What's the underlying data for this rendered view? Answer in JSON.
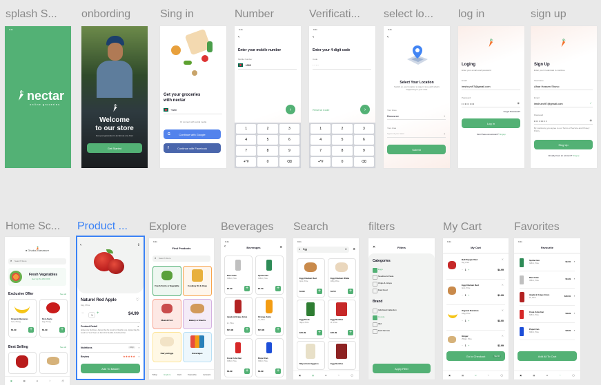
{
  "row1_titles": [
    "splash S...",
    "onbording",
    "Sing in",
    "Number",
    "Verificati...",
    "select lo...",
    "log in",
    "sign up"
  ],
  "row2_titles": [
    "Home Sc...",
    "Product ...",
    "Explore",
    "Beverages",
    "Search",
    "filters",
    "My Cart",
    "Favorites"
  ],
  "colors": {
    "brand_green": "#53b175",
    "selected_blue": "#3b82f6",
    "canvas": "#e9e9e9"
  },
  "splash": {
    "logo": "nectar",
    "tagline": "online groceries"
  },
  "onboarding": {
    "title_line1": "Welcome",
    "title_line2": "to our store",
    "subtitle": "Get your groceries in as fast as one hour",
    "button": "Get Started"
  },
  "signin": {
    "title_line1": "Get your groceries",
    "title_line2": "with nectar",
    "phone": "+880",
    "social_note": "Or connect with social media",
    "google_btn": "Continue with Google",
    "facebook_btn": "Continue with Facebook"
  },
  "number": {
    "title": "Enter your mobile number",
    "label": "Mobile Number",
    "value": "+880",
    "keys": [
      "1",
      "2",
      "3",
      "4",
      "5",
      "6",
      "7",
      "8",
      "9",
      "+*#",
      "0",
      "⌫"
    ]
  },
  "verification": {
    "title": "Enter your 4-digit code",
    "label": "Code",
    "resend": "Resend Code",
    "keys": [
      "1",
      "2",
      "3",
      "4",
      "5",
      "6",
      "7",
      "8",
      "9",
      "+*#",
      "0",
      "⌫"
    ]
  },
  "location": {
    "title": "Select Your Location",
    "subtitle": "Switch on your location to stay in tune with what's happening in your area",
    "zone_label": "Your Zone",
    "zone_value": "Banasree",
    "area_label": "Your Area",
    "area_placeholder": "Types of your area",
    "button": "Submit"
  },
  "login": {
    "title": "Loging",
    "subtitle": "Enter your emails and password",
    "email_label": "Email",
    "email_value": "imshuvo97@gmail.com",
    "password_label": "Password",
    "password_value": "••••••••",
    "forgot": "Forgot Password?",
    "button": "Log In",
    "signup_prompt": "Don't have an account?",
    "signup_link": "Singup"
  },
  "signup": {
    "title": "Sign Up",
    "subtitle": "Enter your credentials to continue",
    "username_label": "Username",
    "username_value": "Afsar Hossen Shuvo",
    "email_label": "Email",
    "email_value": "imshuvo97@gmail.com",
    "password_label": "Password",
    "password_value": "••••••••",
    "terms": "By continuing you agree to our Terms of Service and Privacy Policy.",
    "button": "Sing Up",
    "login_prompt": "Already have an account?",
    "login_link": "Singup"
  },
  "home": {
    "location": "Dhaka, Banassre",
    "search": "Search Store",
    "banner_title": "Fresh Vegetables",
    "banner_sub": "Get Up To 40% OFF",
    "section1": "Exclusive Offer",
    "see_all": "See all",
    "products": [
      {
        "name": "Organic Bananas",
        "qty": "7pcs, Priceg",
        "price": "$4.99"
      },
      {
        "name": "Red Apple",
        "qty": "1kg, Priceg",
        "price": "$4.99"
      }
    ],
    "section2": "Best Selling"
  },
  "product": {
    "name": "Naturel Red Apple",
    "qty": "1kg, Price",
    "price": "$4.99",
    "count": "1",
    "detail_label": "Product Detail",
    "detail_text": "Apples Are Nutritious. Apples May Be Good For Weight Loss. Apples May Be Good For Your Heart. As Part Of A Healtful And Varied Diet.",
    "nutrition": "Nutritions",
    "nutrition_value": "100gr",
    "review": "Review",
    "stars": "★★★★★",
    "button": "Add To Basket"
  },
  "explore": {
    "title": "Find Products",
    "search": "Search Store",
    "categories": [
      {
        "label": "Frash Fruits & Vegetable",
        "bg": "#eef7f1",
        "border": "#53b175"
      },
      {
        "label": "Cooking Oil & Ghee",
        "bg": "#fef6ed",
        "border": "#f8a44c"
      },
      {
        "label": "Meat & Fish",
        "bg": "#fde8e4",
        "border": "#f7a593"
      },
      {
        "label": "Bakery & Snacks",
        "bg": "#f4ebf7",
        "border": "#d3b0e0"
      },
      {
        "label": "Dairy & Eggs",
        "bg": "#fff8e5",
        "border": "#fde598"
      },
      {
        "label": "Beverages",
        "bg": "#edf7fc",
        "border": "#b7dff5"
      }
    ],
    "tabs": [
      "Shop",
      "Explore",
      "Cart",
      "Favourite",
      "Account"
    ]
  },
  "beverages": {
    "title": "Beverages",
    "items": [
      {
        "name": "Diet Coke",
        "qty": "355ml, Price",
        "price": "$1.99"
      },
      {
        "name": "Sprite Can",
        "qty": "325ml, Price",
        "price": "$1.50"
      },
      {
        "name": "Apple & Grape Juice",
        "qty": "2L, Price",
        "price": "$15.99"
      },
      {
        "name": "Orenge Juice",
        "qty": "2L, Price",
        "price": "$15.99"
      },
      {
        "name": "Coca Cola Can",
        "qty": "325ml, Price",
        "price": "$4.99"
      },
      {
        "name": "Pepsi Can",
        "qty": "330ml, Price",
        "price": "$4.99"
      }
    ]
  },
  "search": {
    "query": "Egg",
    "items": [
      {
        "name": "Egg Chicken Red",
        "qty": "4pcs, Price",
        "price": "$1.99"
      },
      {
        "name": "Egg Chicken White",
        "qty": "180g, Price",
        "price": "$1.50"
      },
      {
        "name": "Egg Pasta",
        "qty": "30gm, Price",
        "price": "$15.99"
      },
      {
        "name": "Egg Noodles",
        "qty": "2L, Price",
        "price": "$15.99"
      },
      {
        "name": "Mayonnais Eggless",
        "qty": "",
        "price": ""
      },
      {
        "name": "Egg Noodles",
        "qty": "",
        "price": ""
      }
    ]
  },
  "filters": {
    "title": "Filters",
    "categories_label": "Categories",
    "categories": [
      {
        "label": "Eggs",
        "on": true
      },
      {
        "label": "Noodles & Pasta",
        "on": false
      },
      {
        "label": "Chips & Crisps",
        "on": false
      },
      {
        "label": "Fast Food",
        "on": false
      }
    ],
    "brand_label": "Brand",
    "brands": [
      {
        "label": "Individual Callection",
        "on": false
      },
      {
        "label": "Cocola",
        "on": true
      },
      {
        "label": "Ifad",
        "on": false
      },
      {
        "label": "Kazi Farmas",
        "on": false
      }
    ],
    "button": "Apply Filter"
  },
  "cart": {
    "title": "My Cart",
    "items": [
      {
        "name": "Bell Pepper Red",
        "qty": "1kg, Price",
        "price": "$4.99"
      },
      {
        "name": "Egg Chicken Red",
        "qty": "4pcs, Price",
        "price": "$1.99"
      },
      {
        "name": "Organic Bananas",
        "qty": "12kg, Price",
        "price": "$3.00"
      },
      {
        "name": "Ginger",
        "qty": "250gm, Price",
        "price": "$2.99"
      }
    ],
    "button": "Go to Checkout",
    "total": "$12.96"
  },
  "favorites": {
    "title": "Favourite",
    "items": [
      {
        "name": "Sprite Can",
        "qty": "325ml, Price",
        "price": "$1.50"
      },
      {
        "name": "Diet Coke",
        "qty": "355ml, Price",
        "price": "$1.99"
      },
      {
        "name": "Apple & Grape Juice",
        "qty": "2L, Price",
        "price": "$15.50"
      },
      {
        "name": "Coca Cola Can",
        "qty": "325ml, Price",
        "price": "$4.99"
      },
      {
        "name": "Pepsi Can",
        "qty": "330ml, Price",
        "price": "$4.99"
      }
    ],
    "button": "Add All To Cart"
  }
}
